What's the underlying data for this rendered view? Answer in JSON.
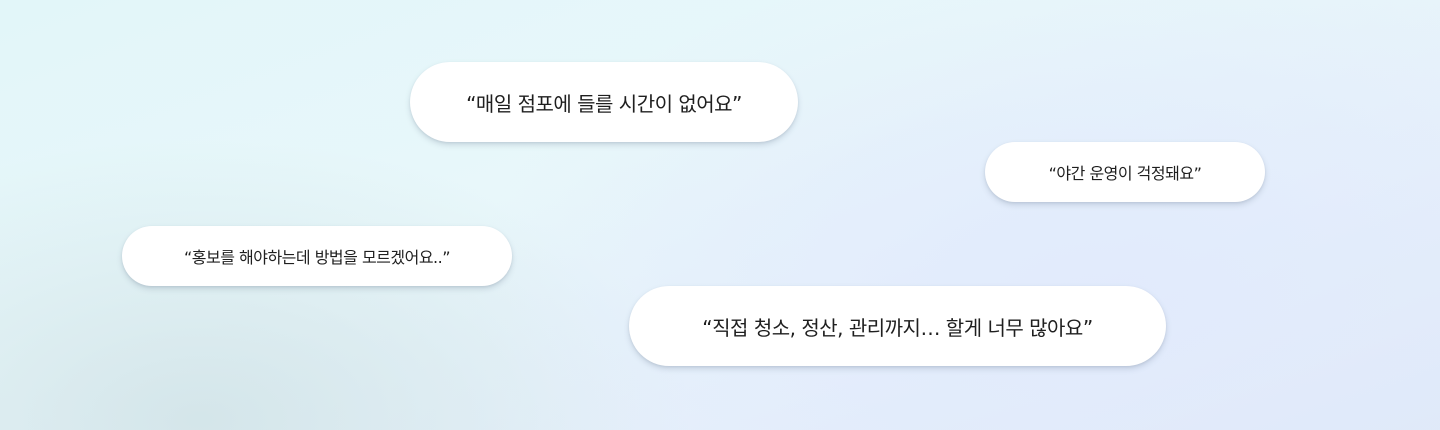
{
  "quotes": [
    "“매일 점포에 들를 시간이 없어요”",
    "“야간 운영이 걱정돼요”",
    "“홍보를 해야하는데 방법을 모르겠어요..”",
    "“직접 청소, 정산, 관리까지… 할게 너무 많아요”"
  ]
}
